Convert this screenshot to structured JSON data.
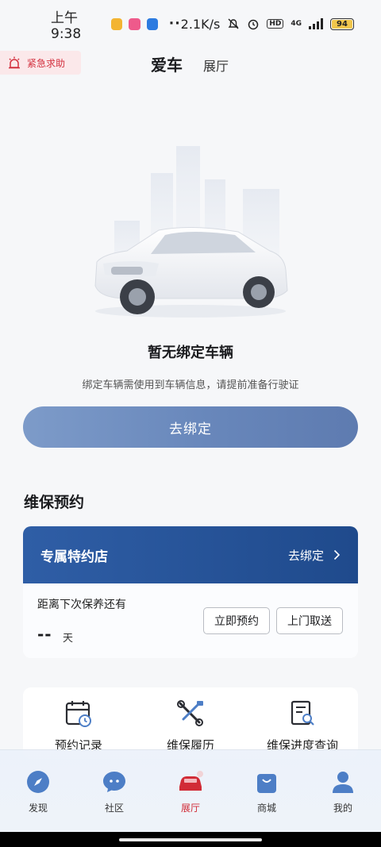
{
  "status_bar": {
    "time": "上午9:38",
    "dots": "··",
    "speed": "2.1K/s",
    "network": "4G",
    "battery": "94",
    "app_colors": [
      "#f3b432",
      "#ee5a8b",
      "#2d7be0"
    ]
  },
  "header": {
    "sos_label": "紧急求助",
    "tabs": [
      "爱车",
      "展厅"
    ],
    "active_tab": "爱车"
  },
  "empty_state": {
    "title": "暂无绑定车辆",
    "subtitle": "绑定车辆需使用到车辆信息，请提前准备行驶证",
    "bind_button": "去绑定"
  },
  "maintenance": {
    "section_title": "维保预约",
    "dealer_label": "专属特约店",
    "dealer_action": "去绑定",
    "next_service_label": "距离下次保养还有",
    "next_service_value": "--",
    "next_service_unit": "天",
    "book_button": "立即预约",
    "pickup_button": "上门取送"
  },
  "services": [
    {
      "label": "预约记录",
      "icon": "calendar-icon"
    },
    {
      "label": "维保履历",
      "icon": "tools-icon"
    },
    {
      "label": "维保进度查询",
      "icon": "progress-doc-icon"
    }
  ],
  "bottom_nav": [
    {
      "label": "发现",
      "icon": "compass-icon"
    },
    {
      "label": "社区",
      "icon": "chat-icon"
    },
    {
      "label": "展厅",
      "icon": "car-icon"
    },
    {
      "label": "商城",
      "icon": "shopping-bag-icon"
    },
    {
      "label": "我的",
      "icon": "user-icon"
    }
  ],
  "active_nav": "展厅",
  "colors": {
    "brand_red": "#d12b36",
    "bind_button": "#6887bb",
    "dealer_header": "#2f5ea6",
    "nav_blue": "#4d7ec6"
  }
}
